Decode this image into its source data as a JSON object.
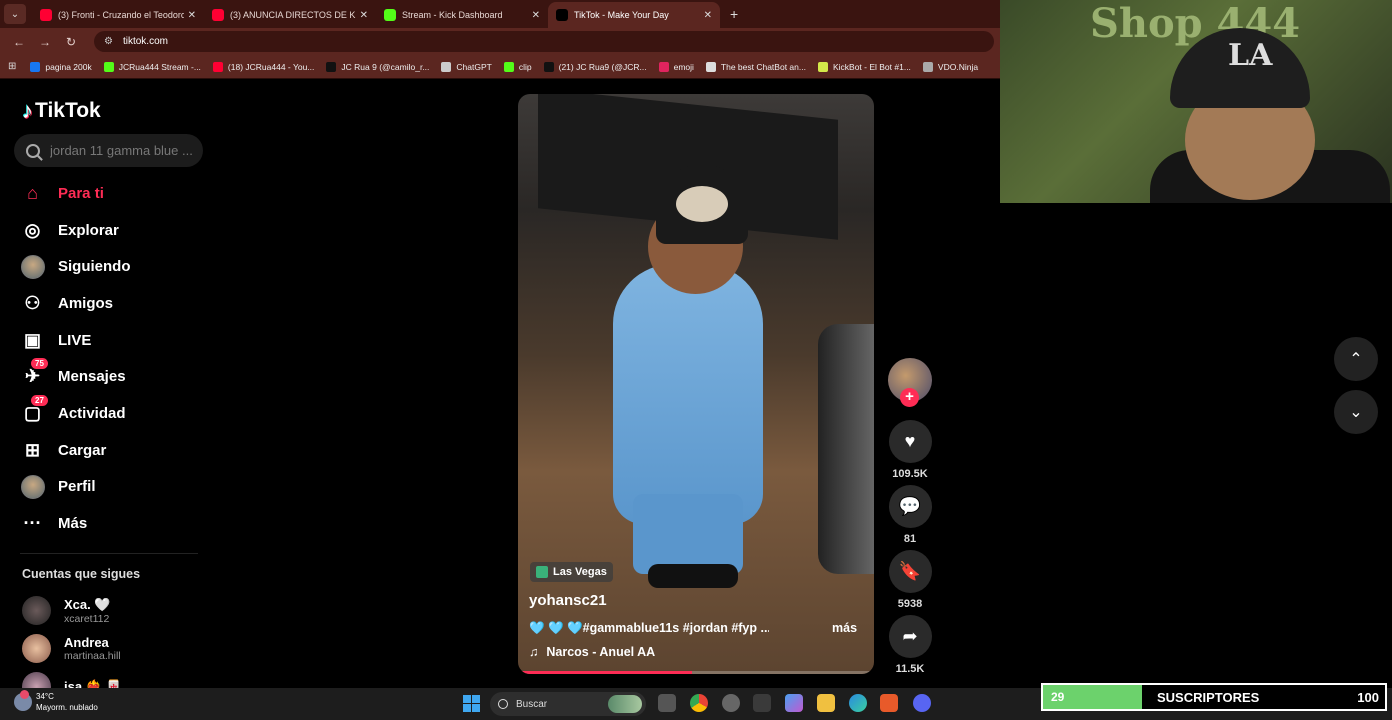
{
  "browser": {
    "tabs": [
      {
        "title": "(3) Fronti - Cruzando el Teodoro",
        "color": "#ff0033",
        "active": false
      },
      {
        "title": "(3) ANUNCIA DIRECTOS DE KICK",
        "color": "#ff0033",
        "active": false
      },
      {
        "title": "Stream - Kick Dashboard",
        "color": "#53fc18",
        "active": false
      },
      {
        "title": "TikTok - Make Your Day",
        "color": "#000000",
        "active": true
      }
    ],
    "url": "tiktok.com",
    "bookmarks": [
      {
        "label": "pagina 200k",
        "color": "#1877f2"
      },
      {
        "label": "JCRua444 Stream -...",
        "color": "#53fc18"
      },
      {
        "label": "(18) JCRua444 - You...",
        "color": "#ff0033"
      },
      {
        "label": "JC Rua 9 (@camilo_r...",
        "color": "#111111"
      },
      {
        "label": "ChatGPT",
        "color": "#cccccc"
      },
      {
        "label": "clip",
        "color": "#53fc18"
      },
      {
        "label": "(21) JC Rua9 (@JCR...",
        "color": "#111111"
      },
      {
        "label": "emoji",
        "color": "#e0245e"
      },
      {
        "label": "The best ChatBot an...",
        "color": "#dddddd"
      },
      {
        "label": "KickBot - El Bot #1...",
        "color": "#d4e84a"
      },
      {
        "label": "VDO.Ninja",
        "color": "#aaaaaa"
      }
    ]
  },
  "tiktok": {
    "logo": "TikTok",
    "search_placeholder": "jordan 11 gamma blue ...",
    "menu": [
      {
        "label": "Para ti",
        "icon": "home-icon",
        "glyph": "⌂",
        "active": true
      },
      {
        "label": "Explorar",
        "icon": "compass-icon",
        "glyph": "◎"
      },
      {
        "label": "Siguiendo",
        "icon": "following-avatar-icon",
        "glyph": ""
      },
      {
        "label": "Amigos",
        "icon": "friends-icon",
        "glyph": "⚇"
      },
      {
        "label": "LIVE",
        "icon": "live-tv-icon",
        "glyph": "▣"
      },
      {
        "label": "Mensajes",
        "icon": "messages-icon",
        "glyph": "✈",
        "badge": "75"
      },
      {
        "label": "Actividad",
        "icon": "activity-icon",
        "glyph": "▢",
        "badge": "27"
      },
      {
        "label": "Cargar",
        "icon": "upload-icon",
        "glyph": "⊞"
      },
      {
        "label": "Perfil",
        "icon": "profile-avatar-icon",
        "glyph": ""
      },
      {
        "label": "Más",
        "icon": "more-icon",
        "glyph": "···"
      }
    ],
    "following_title": "Cuentas que sigues",
    "following": [
      {
        "name": "Xca. 🤍",
        "handle": "xcaret112"
      },
      {
        "name": "Andrea",
        "handle": "martinaa.hill"
      },
      {
        "name": "isa ❤️‍🔥 🀄",
        "handle": ""
      }
    ],
    "video": {
      "location": "Las Vegas",
      "username": "yohansc21",
      "description": "🩵 🩵 🩵#gammablue11s #jordan #fyp ...",
      "more": "más",
      "music": "Narcos - Anuel AA",
      "progress_percent": 49
    },
    "actions": {
      "likes": "109.5K",
      "comments": "81",
      "saves": "5938",
      "shares": "11.5K"
    }
  },
  "overlay": {
    "webcam_text": "Shop 444",
    "cap_logo": "LA",
    "subs_count": "29",
    "subs_label": "SUSCRIPTORES",
    "subs_goal": "100",
    "subs_fill_percent": 29
  },
  "taskbar": {
    "temperature": "34°C",
    "weather": "Mayorm. nublado",
    "search_label": "Buscar"
  }
}
